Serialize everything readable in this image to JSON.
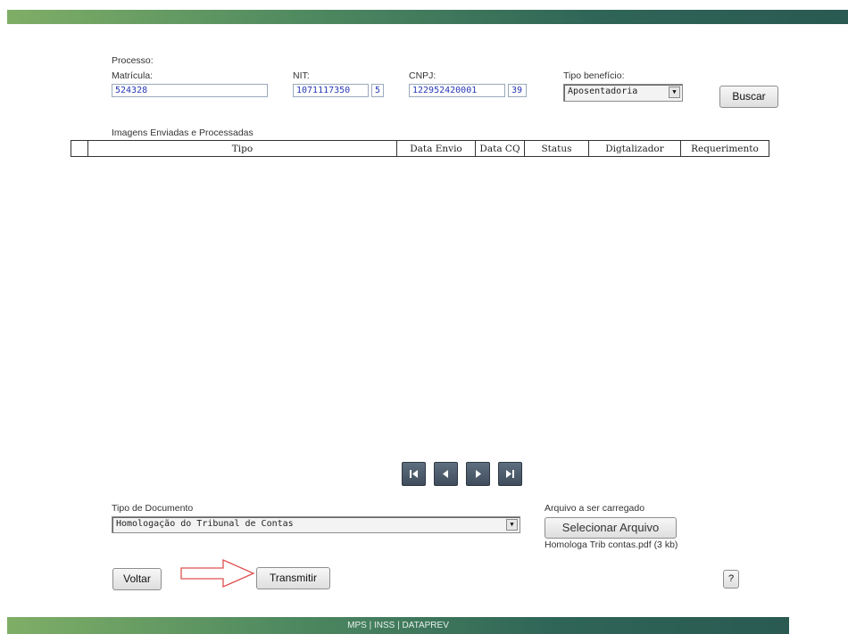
{
  "form": {
    "processo_label": "Processo:",
    "matricula": {
      "label": "Matrícula:",
      "value": "524328"
    },
    "nit": {
      "label": "NIT:",
      "value": "1071117350",
      "digit": "5"
    },
    "cnpj": {
      "label": "CNPJ:",
      "value": "122952420001",
      "digit": "39"
    },
    "tipo_beneficio": {
      "label": "Tipo benefício:",
      "selected": "Aposentadoria"
    },
    "buscar_label": "Buscar"
  },
  "table": {
    "caption": "Imagens Enviadas e Processadas",
    "columns": [
      "",
      "Tipo",
      "Data Envio",
      "Data CQ",
      "Status",
      "Digtalizador",
      "Requerimento"
    ]
  },
  "pager": {
    "icons": [
      "first-page-icon",
      "previous-page-icon",
      "next-page-icon",
      "last-page-icon"
    ]
  },
  "upload": {
    "tipo_documento_label": "Tipo de Documento",
    "tipo_documento_selected": "Homologação do Tribunal de Contas",
    "arquivo_label": "Arquivo a ser carregado",
    "selecionar_label": "Selecionar Arquivo",
    "file_info": "Homologa Trib contas.pdf (3 kb)"
  },
  "actions": {
    "voltar_label": "Voltar",
    "transmitir_label": "Transmitir",
    "help_label": "?"
  },
  "footer": {
    "text": "MPS | INSS | DATAPREV"
  },
  "colors": {
    "header_green": "#2f6557",
    "link_blue": "#2637b5",
    "annotation_red": "#e05050"
  }
}
